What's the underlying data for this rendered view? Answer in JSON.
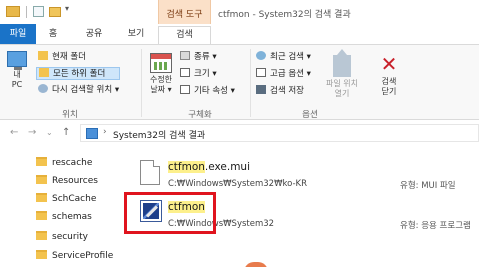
{
  "titlebar": {
    "tool_tab": "검색 도구",
    "title": "ctfmon - System32의 검색 결과"
  },
  "tabs": {
    "file": "파일",
    "home": "홈",
    "share": "공유",
    "view": "보기",
    "search": "검색"
  },
  "ribbon": {
    "location": {
      "pc_label": "내\nPC",
      "pc_line1": "내",
      "pc_line2": "PC",
      "current_folder": "현재 폴더",
      "all_subfolders": "모든 하위 폴더",
      "search_again": "다시 검색할 위치 ▾",
      "group_label": "위치"
    },
    "refine": {
      "date_line1": "수정한",
      "date_line2": "날짜 ▾",
      "kind": "종류 ▾",
      "size": "크기 ▾",
      "other": "기타 속성 ▾",
      "group_label": "구체화"
    },
    "options": {
      "recent": "최근 검색 ▾",
      "advanced": "고급 옵션 ▾",
      "save": "검색 저장",
      "open_loc_line1": "파일 위치",
      "open_loc_line2": "열기",
      "close_line1": "검색",
      "close_line2": "닫기",
      "group_label": "옵션"
    }
  },
  "address": {
    "path": "System32의 검색 결과"
  },
  "tree": {
    "items": [
      "rescache",
      "Resources",
      "SchCache",
      "schemas",
      "security",
      "ServiceProfile"
    ]
  },
  "results": [
    {
      "name_highlight": "ctfmon",
      "name_rest": ".exe.mui",
      "path": "C:₩Windows₩System32₩ko-KR",
      "type": "유형: MUI 파일",
      "icon": "document-icon"
    },
    {
      "name_highlight": "ctfmon",
      "name_rest": "",
      "path": "C:₩Windows₩System32",
      "type": "유형: 응용 프로그램",
      "icon": "application-icon"
    }
  ],
  "colors": {
    "file_tab": "#1a73c8",
    "tool_tab": "#fbe0c8",
    "highlight": "#fdf08c",
    "annotation_box": "#e0141e"
  }
}
